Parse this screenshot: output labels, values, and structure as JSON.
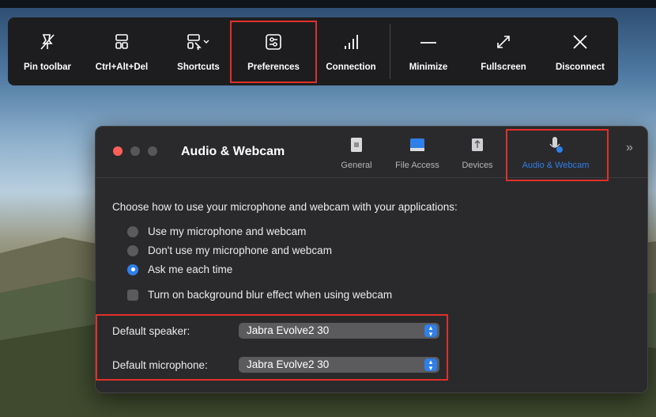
{
  "toolbar": {
    "items": [
      {
        "label": "Pin toolbar",
        "icon": "pin-off-icon"
      },
      {
        "label": "Ctrl+Alt+Del",
        "icon": "keyboard-keys-icon"
      },
      {
        "label": "Shortcuts",
        "icon": "shortcuts-icon"
      },
      {
        "label": "Preferences",
        "icon": "sliders-icon"
      },
      {
        "label": "Connection",
        "icon": "signal-bars-icon"
      },
      {
        "label": "Minimize",
        "icon": "minus-icon"
      },
      {
        "label": "Fullscreen",
        "icon": "expand-arrows-icon"
      },
      {
        "label": "Disconnect",
        "icon": "close-x-icon"
      }
    ],
    "highlighted": "Preferences"
  },
  "dialog": {
    "title": "Audio & Webcam",
    "tabs": [
      {
        "label": "General",
        "icon": "general-icon"
      },
      {
        "label": "File Access",
        "icon": "folder-icon"
      },
      {
        "label": "Devices",
        "icon": "usb-icon"
      },
      {
        "label": "Audio & Webcam",
        "icon": "microphone-icon",
        "active": true
      }
    ],
    "prompt": "Choose how to use your microphone and webcam with your applications:",
    "options": [
      {
        "label": "Use my microphone and webcam",
        "selected": false
      },
      {
        "label": "Don't use my microphone and webcam",
        "selected": false
      },
      {
        "label": "Ask me each time",
        "selected": true
      }
    ],
    "blur_label": "Turn on background blur effect when using webcam",
    "blur_checked": false,
    "speaker_label": "Default speaker:",
    "speaker_value": "Jabra Evolve2 30",
    "microphone_label": "Default microphone:",
    "microphone_value": "Jabra Evolve2 30"
  },
  "colors": {
    "accent": "#2f7fea",
    "highlight": "#e0302a",
    "close": "#ff5f57"
  }
}
